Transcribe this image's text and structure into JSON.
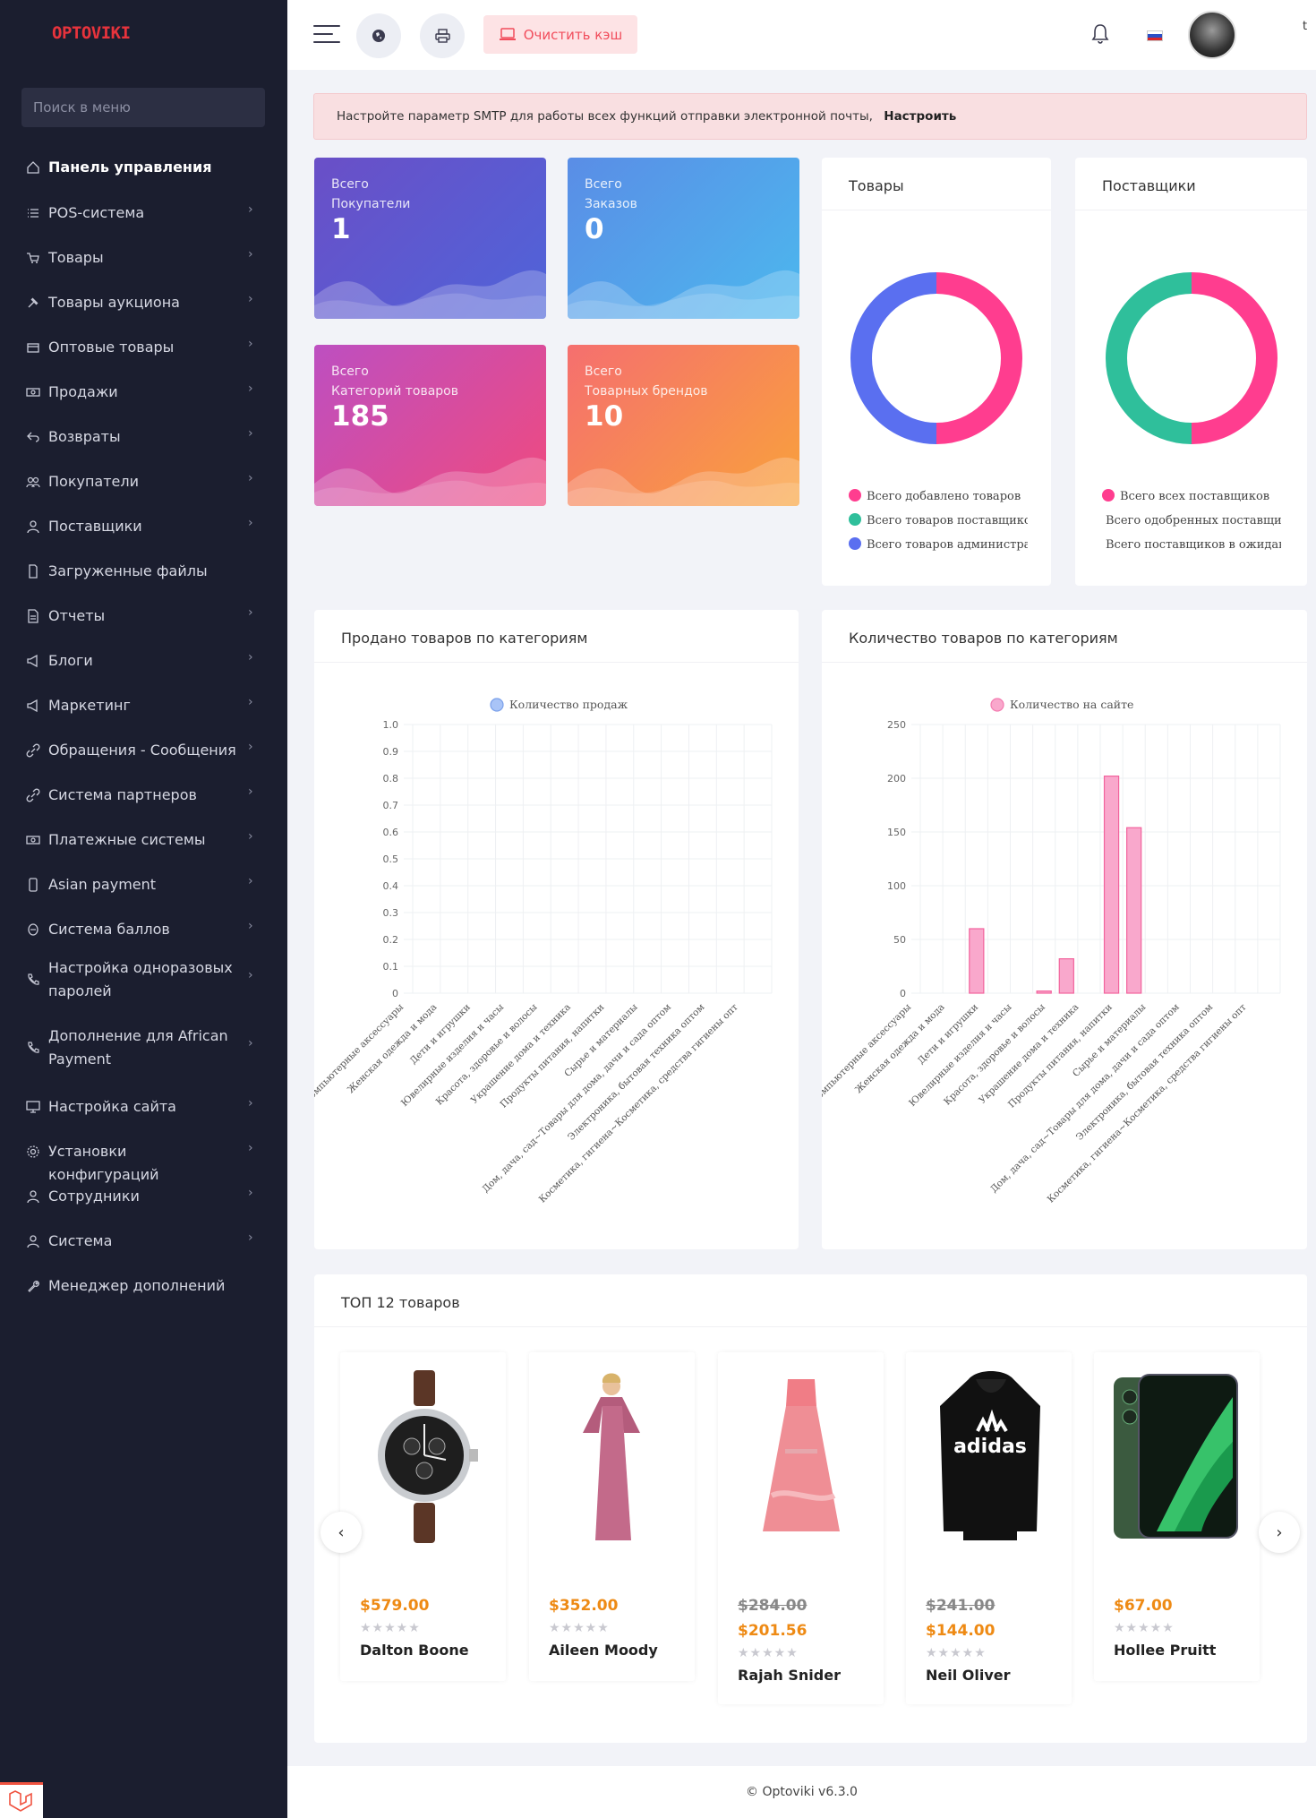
{
  "sidebar": {
    "logo": "OPTOVIKI",
    "search_placeholder": "Поиск в меню",
    "items": [
      {
        "label": "Панель управления",
        "icon": "home-icon",
        "active": true,
        "chev": false
      },
      {
        "label": "POS-система",
        "icon": "list-icon",
        "chev": true
      },
      {
        "label": "Товары",
        "icon": "cart-icon",
        "chev": true
      },
      {
        "label": "Товары аукциона",
        "icon": "gavel-icon",
        "chev": true
      },
      {
        "label": "Оптовые товары",
        "icon": "box-icon",
        "chev": true
      },
      {
        "label": "Продажи",
        "icon": "money-icon",
        "chev": true
      },
      {
        "label": "Возвраты",
        "icon": "return-icon",
        "chev": true
      },
      {
        "label": "Покупатели",
        "icon": "users-icon",
        "chev": true
      },
      {
        "label": "Поставщики",
        "icon": "user-icon",
        "chev": true
      },
      {
        "label": "Загруженные файлы",
        "icon": "file-icon",
        "chev": false
      },
      {
        "label": "Отчеты",
        "icon": "report-icon",
        "chev": true
      },
      {
        "label": "Блоги",
        "icon": "megaphone-icon",
        "chev": true
      },
      {
        "label": "Маркетинг",
        "icon": "megaphone-icon",
        "chev": true
      },
      {
        "label": "Обращения - Сообщения",
        "icon": "link-icon",
        "chev": true
      },
      {
        "label": "Система партнеров",
        "icon": "link-icon",
        "chev": true
      },
      {
        "label": "Платежные системы",
        "icon": "money-icon",
        "chev": true
      },
      {
        "label": "Asian payment",
        "icon": "phone-icon",
        "chev": true
      },
      {
        "label": "Система баллов",
        "icon": "coin-icon",
        "chev": true
      },
      {
        "label": "Настройка одноразовых паролей",
        "icon": "phone-call-icon",
        "chev": true
      },
      {
        "label": "Дополнение для African Payment",
        "icon": "phone-call-icon",
        "chev": true
      },
      {
        "label": "Настройка сайта",
        "icon": "monitor-icon",
        "chev": true
      },
      {
        "label": "Установки конфигураций",
        "icon": "gear-icon",
        "chev": true
      },
      {
        "label": "Сотрудники",
        "icon": "user-icon",
        "chev": true
      },
      {
        "label": "Система",
        "icon": "user-icon",
        "chev": true
      },
      {
        "label": "Менеджер дополнений",
        "icon": "wrench-icon",
        "chev": false
      }
    ]
  },
  "topbar": {
    "clear_cache_label": "Очистить кэш",
    "extra_char": "t"
  },
  "alert": {
    "text": "Настройте параметр SMTP для работы всех функций отправки электронной почты,",
    "link": "Настроить"
  },
  "stats": [
    {
      "line1": "Всего",
      "line2": "Покупатели",
      "value": "1",
      "from": "#6a4fc7",
      "to": "#4f64d9"
    },
    {
      "line1": "Всего",
      "line2": "Заказов",
      "value": "0",
      "from": "#5a8de6",
      "to": "#4cb8ee"
    },
    {
      "line1": "Всего",
      "line2": "Категорий товаров",
      "value": "185",
      "from": "#bd4fc1",
      "to": "#f04a7e"
    },
    {
      "line1": "Всего",
      "line2": "Товарных брендов",
      "value": "10",
      "from": "#f56f6f",
      "to": "#f9a23b"
    }
  ],
  "donuts": [
    {
      "title": "Товары",
      "legend": [
        "Всего добавлено товаров",
        "Всего товаров поставщиков",
        "Всего товаров администратора"
      ],
      "colors": [
        "#ff3d8f",
        "#2fbf9b",
        "#5a6ff0"
      ],
      "values": [
        50,
        0,
        50
      ]
    },
    {
      "title": "Поставщики",
      "legend": [
        "Всего всех поставщиков",
        "Всего одобренных поставщиков",
        "Всего поставщиков в ожидании"
      ],
      "colors": [
        "#ff3d8f",
        "#2fbf9b",
        "#5a6ff0"
      ],
      "values": [
        50,
        50,
        0
      ]
    }
  ],
  "chart_data": [
    {
      "type": "bar",
      "title": "Продано товаров по категориям",
      "series": [
        {
          "name": "Количество продаж",
          "values": [
            0,
            0,
            0,
            0,
            0,
            0,
            0,
            0,
            0,
            0,
            0,
            0,
            0
          ]
        }
      ],
      "categories": [
        "Компьютерные аксессуары",
        "Женская одежда и мода",
        "Дети и игрушки",
        "Ювелирные изделия и часы",
        "Красота, здоровье и волосы",
        "Украшение дома и техника",
        "Продукты питания, напитки",
        "Сырье и материалы",
        "Дом, дача, сад~Товары для дома, дачи и сада оптом",
        "Электроника, бытовая техника оптом",
        "Косметика, гигиена~Косметика, средства гигиены опт"
      ],
      "ylim": [
        0,
        1
      ],
      "yticks": [
        "1.0",
        "0.9",
        "0.8",
        "0.7",
        "0.6",
        "0.5",
        "0.4",
        "0.3",
        "0.2",
        "0.1",
        "0"
      ],
      "color": "#a9c4f7"
    },
    {
      "type": "bar",
      "title": "Количество товаров по категориям",
      "series": [
        {
          "name": "Количество на сайте",
          "values": [
            0,
            0,
            60,
            0,
            0,
            2,
            32,
            0,
            202,
            154,
            0,
            0,
            0,
            0,
            0,
            0
          ]
        }
      ],
      "categories": [
        "Компьютерные аксессуары",
        "Женская одежда и мода",
        "Дети и игрушки",
        "Ювелирные изделия и часы",
        "Красота, здоровье и волосы",
        "Украшение дома и техника",
        "Продукты питания, напитки",
        "Сырье и материалы",
        "Дом, дача, сад~Товары для дома, дачи и сада оптом",
        "Электроника, бытовая техника оптом",
        "Косметика, гигиена~Косметика, средства гигиены опт"
      ],
      "ylim": [
        0,
        250
      ],
      "yticks": [
        "250",
        "200",
        "150",
        "100",
        "50",
        "0"
      ],
      "color": "#f9a8cc"
    }
  ],
  "top": {
    "title": "ТОП 12 товаров",
    "products": [
      {
        "old": "",
        "price": "$579.00",
        "name": "Dalton Boone",
        "stars": "★★★★★",
        "img": "watch-image"
      },
      {
        "old": "",
        "price": "$352.00",
        "name": "Aileen Moody",
        "stars": "★★★★★",
        "img": "dress-image"
      },
      {
        "old": "$284.00",
        "price": "$201.56",
        "name": "Rajah Snider",
        "stars": "★★★★★",
        "img": "pink-dress-image"
      },
      {
        "old": "$241.00",
        "price": "$144.00",
        "name": "Neil Oliver",
        "stars": "★★★★★",
        "img": "hoodie-image"
      },
      {
        "old": "",
        "price": "$67.00",
        "name": "Hollee Pruitt",
        "stars": "★★★★★",
        "img": "phone-image"
      }
    ]
  },
  "footer": {
    "text": "© Optoviki v6.3.0"
  }
}
